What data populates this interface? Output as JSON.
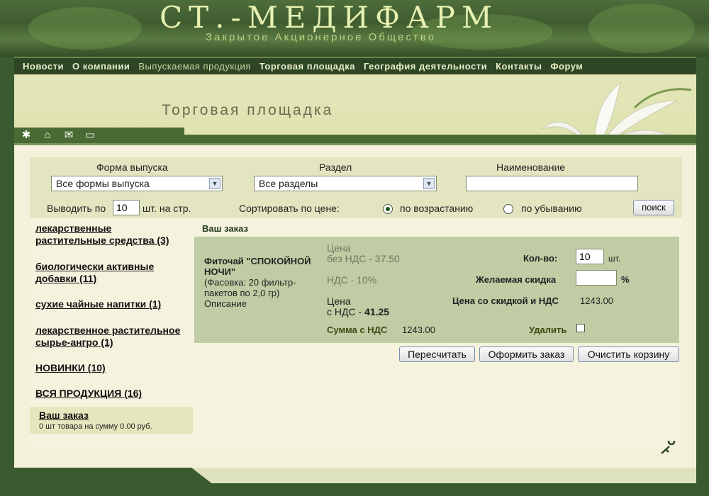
{
  "header": {
    "logo": "СТ.-МЕДИФАРМ",
    "logo_sub": "Закрытое Акционерное Общество"
  },
  "menu": [
    "Новости",
    "О компании",
    "Выпускаемая продукция",
    "Торговая площадка",
    "География деятельности",
    "Контакты",
    "Форум"
  ],
  "page_title": "Торговая площадка",
  "toolbar_icons": [
    "sun-icon",
    "home-icon",
    "mail-icon",
    "sitemap-icon"
  ],
  "filters": {
    "form_label": "Форма выпуска",
    "form_value": "Все формы выпуска",
    "section_label": "Раздел",
    "section_value": "Все разделы",
    "name_label": "Наименование",
    "name_value": "",
    "per_page_prefix": "Выводить по",
    "per_page_value": "10",
    "per_page_suffix": "шт. на стр.",
    "sort_label": "Сортировать по цене:",
    "sort_asc": "по возрастанию",
    "sort_desc": "по убыванию",
    "sort_selected": "asc",
    "search_button": "поиск"
  },
  "categories": [
    {
      "line1": "лекарственные",
      "line2": "растительные средства (3)"
    },
    {
      "line1": "биологически активные",
      "line2": "добавки (11)"
    },
    {
      "line1": "сухие чайные напитки (1)",
      "line2": ""
    },
    {
      "line1": "лекарственное растительное",
      "line2": "сырье-ангро (1)"
    },
    {
      "line1": "НОВИНКИ (10)",
      "line2": ""
    },
    {
      "line1": "ВСЯ ПРОДУКЦИЯ (16)",
      "line2": ""
    }
  ],
  "cart_summary": {
    "title": "Ваш заказ",
    "text": "0 шт товара на сумму 0.00 руб."
  },
  "order": {
    "heading": "Ваш заказ",
    "product_name": "Фиточай \"СПОКОЙНОЙ НОЧИ\"",
    "product_pack": "(Фасовка: 20 фильтр-пакетов по 2,0 гр)",
    "product_desc": "Описание",
    "price_no_vat_l1": "Цена",
    "price_no_vat_l2": "без НДС - 37.50",
    "vat": "НДС - 10%",
    "price_vat_l1": "Цена",
    "price_vat_l2_prefix": "с НДС - ",
    "price_vat_value": "41.25",
    "sum_label": "Сумма с НДС",
    "sum_value": "1243.00",
    "qty_label": "Кол-во:",
    "qty_value": "10",
    "qty_unit": "шт.",
    "discount_label": "Желаемая скидка",
    "discount_value": "",
    "discount_unit": "%",
    "discounted_label": "Цена со скидкой и НДС",
    "discounted_value": "1243.00",
    "delete_label": "Удалить"
  },
  "actions": {
    "recalc": "Пересчитать",
    "checkout": "Оформить заказ",
    "clear": "Очистить корзину"
  },
  "colors": {
    "accent": "#2e4526",
    "panel": "#e3e5c0",
    "order_box": "#bfcca4"
  }
}
